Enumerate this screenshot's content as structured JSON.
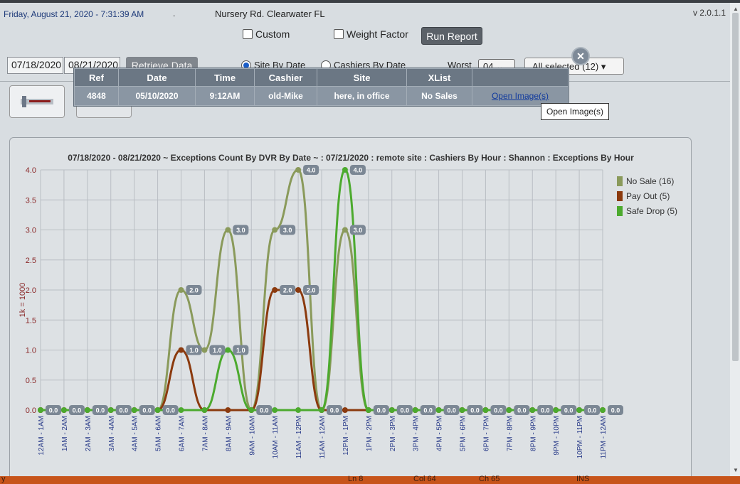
{
  "header": {
    "datetime": "Friday, August 21, 2020 - 7:31:39 AM",
    "dot": ".",
    "location": "Nursery Rd. Clearwater FL",
    "version": "v 2.0.1.1"
  },
  "options": {
    "custom_label": "Custom",
    "weight_factor_label": "Weight Factor",
    "run_report_label": "Run Report"
  },
  "filters": {
    "date_from": "07/18/2020",
    "date_to": "08/21/2020",
    "retrieve_label": "Retrieve Data",
    "radio_site_by_date": "Site By Date",
    "radio_cashiers_by_date": "Cashiers By Date",
    "worst_label": "Worst",
    "worst_value": "04",
    "all_selected": "All selected (12)"
  },
  "popup": {
    "headers": [
      "Ref",
      "Date",
      "Time",
      "Cashier",
      "Site",
      "XList",
      ""
    ],
    "row": {
      "ref": "4848",
      "date": "05/10/2020",
      "time": "9:12AM",
      "cashier": "old-Mike",
      "site": "here, in office",
      "xlist": "No Sales",
      "link": "Open Image(s)"
    },
    "tooltip": "Open Image(s)"
  },
  "statusbar": {
    "left": "y",
    "ln": "Ln 8",
    "col": "Col 64",
    "ch": "Ch 65",
    "ins": "INS"
  },
  "chart_data": {
    "type": "line",
    "title": "07/18/2020 - 08/21/2020 ~ Exceptions Count By DVR By Date ~  : 07/21/2020 : remote site : Cashiers By Hour : Shannon : Exceptions By Hour",
    "xlabel": "",
    "ylabel": "1k = 1000",
    "ylim": [
      0,
      4.0
    ],
    "yticks": [
      "0.0",
      "0.5",
      "1.0",
      "1.5",
      "2.0",
      "2.5",
      "3.0",
      "3.5",
      "4.0"
    ],
    "legend_position": "top-right",
    "grid": true,
    "categories": [
      "12AM - 1AM",
      "1AM - 2AM",
      "2AM - 3AM",
      "3AM - 4AM",
      "4AM - 5AM",
      "5AM - 6AM",
      "6AM - 7AM",
      "7AM - 8AM",
      "8AM - 9AM",
      "9AM - 10AM",
      "10AM - 11AM",
      "11AM - 12PM",
      "11AM - 12AM",
      "12PM - 1PM",
      "1PM - 2PM",
      "2PM - 3PM",
      "3PM - 4PM",
      "4PM - 5PM",
      "5PM - 6PM",
      "6PM - 7PM",
      "7PM - 8PM",
      "8PM - 9PM",
      "9PM - 10PM",
      "10PM - 11PM",
      "11PM - 12AM"
    ],
    "series": [
      {
        "name": "No Sale (16)",
        "color": "#8a9a5b",
        "values": [
          0,
          0,
          0,
          0,
          0,
          0,
          2,
          1,
          3,
          0,
          3,
          4,
          0,
          3,
          0,
          0,
          0,
          0,
          0,
          0,
          0,
          0,
          0,
          0,
          0
        ]
      },
      {
        "name": "Pay Out (5)",
        "color": "#8b3a0e",
        "values": [
          0,
          0,
          0,
          0,
          0,
          0,
          1,
          0,
          0,
          0,
          2,
          2,
          0,
          0,
          0,
          0,
          0,
          0,
          0,
          0,
          0,
          0,
          0,
          0,
          0
        ]
      },
      {
        "name": "Safe Drop (5)",
        "color": "#4caa2e",
        "values": [
          0,
          0,
          0,
          0,
          0,
          0,
          0,
          0,
          1,
          0,
          0,
          0,
          0,
          4,
          0,
          0,
          0,
          0,
          0,
          0,
          0,
          0,
          0,
          0,
          0
        ]
      }
    ]
  }
}
